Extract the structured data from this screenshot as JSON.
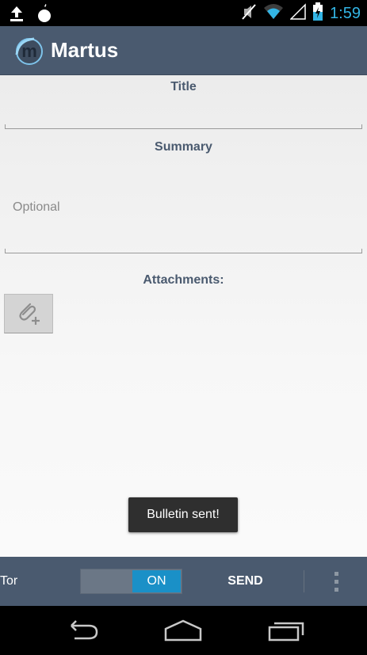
{
  "status_bar": {
    "time": "1:59",
    "icons": [
      "upload-icon",
      "droid-icon",
      "mute-icon",
      "wifi-icon",
      "signal-icon",
      "battery-charging-icon"
    ]
  },
  "action_bar": {
    "logo_icon": "martus-logo",
    "title": "Martus"
  },
  "form": {
    "title_label": "Title",
    "title_value": "",
    "summary_label": "Summary",
    "summary_placeholder": "Optional",
    "attachments_label": "Attachments:",
    "attach_icon": "paperclip-plus-icon"
  },
  "toast": {
    "message": "Bulletin sent!"
  },
  "bottom_bar": {
    "tor_label": "Tor",
    "toggle_state": "ON",
    "send_label": "SEND",
    "overflow_icon": "overflow-menu-icon"
  },
  "nav_bar": {
    "icons": [
      "back-icon",
      "home-icon",
      "recents-icon"
    ]
  },
  "colors": {
    "accent": "#33b5e5",
    "bar": "#4a5a6f",
    "toggle_on": "#1a90c7"
  }
}
